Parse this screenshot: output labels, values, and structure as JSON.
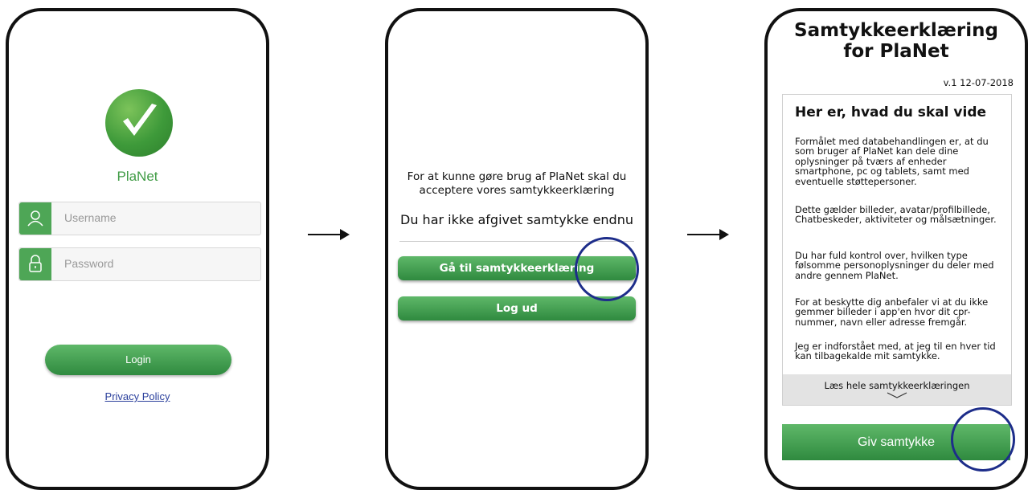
{
  "login_screen": {
    "app_name": "PlaNet",
    "username_placeholder": "Username",
    "password_placeholder": "Password",
    "login_label": "Login",
    "privacy_link": "Privacy Policy",
    "logo_icon": "checkmark-icon"
  },
  "consent_prompt_screen": {
    "info_text": "For at kunne gøre brug af PlaNet skal du acceptere vores samtykkeerklæring",
    "status_text": "Du har ikke afgivet samtykke endnu",
    "consent_button_label": "Gå til samtykkeerklæring",
    "logout_button_label": "Log ud"
  },
  "consent_screen": {
    "title_line1": "Samtykkeerklæring",
    "title_line2": "for PlaNet",
    "version": "v.1 12-07-2018",
    "card_title": "Her er, hvad du skal vide",
    "paragraphs": [
      "Formålet med databehandlingen er, at du som bruger af PlaNet kan dele dine oplysninger på tværs af enheder smartphone, pc og tablets, samt med eventuelle støttepersoner.",
      "Dette gælder billeder, avatar/profilbillede, Chatbeskeder, aktiviteter og målsætninger.",
      "Du har fuld kontrol over, hvilken type følsomme personoplysninger du deler med andre gennem PlaNet.",
      "For at beskytte dig anbefaler vi at du ikke gemmer billeder i app'en hvor dit cpr-nummer, navn eller adresse fremgår.",
      "Jeg er indforstået med, at jeg til en hver tid kan tilbagekalde mit samtykke."
    ],
    "read_more": "Læs hele samtykkeerklæringen",
    "give_consent_label": "Giv samtykke"
  },
  "colors": {
    "brand_green": "#3f9b44",
    "highlight_circle": "#1d2d8a"
  }
}
